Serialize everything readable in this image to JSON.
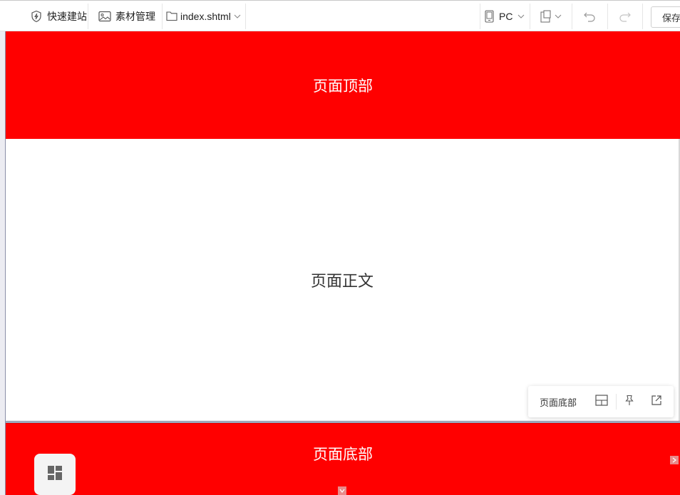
{
  "toolbar": {
    "quick_build_label": "快速建站",
    "assets_label": "素材管理",
    "file_name": "index.shtml",
    "device_label": "PC",
    "save_label": "保存"
  },
  "page": {
    "header_label": "页面顶部",
    "body_label": "页面正文",
    "footer_label": "页面底部"
  },
  "section_toolbar": {
    "label": "页面底部"
  },
  "icons": {
    "quick_build": "shield-bolt-icon",
    "assets": "image-icon",
    "file": "folder-icon",
    "device": "mobile-device-icon",
    "layout_switch": "layout-copy-icon",
    "undo": "undo-icon",
    "redo": "redo-icon",
    "section_layout": "layout-grid-icon",
    "pin": "pin-icon",
    "open_external": "external-link-icon",
    "widgets": "widgets-grid-icon"
  },
  "colors": {
    "section_red": "#ff0000",
    "toolbar_bg": "#ffffff"
  }
}
